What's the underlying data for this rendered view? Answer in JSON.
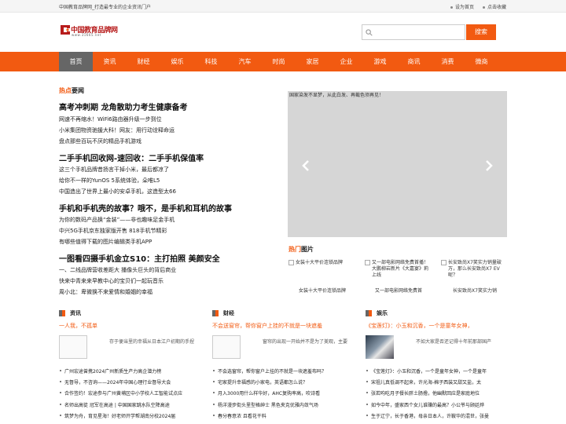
{
  "topbar": {
    "site_desc": "中国教育品牌网_打造最专业的企业资讯门户",
    "set_home": "设为首页",
    "bookmark": "点击收藏"
  },
  "logo": {
    "text": "中国教育品牌网",
    "sub": "www.31665.net"
  },
  "search": {
    "placeholder": "",
    "button": "搜索"
  },
  "nav": [
    "首页",
    "资讯",
    "财经",
    "娱乐",
    "科技",
    "汽车",
    "时尚",
    "家居",
    "企业",
    "游戏",
    "商讯",
    "消费",
    "微商"
  ],
  "hot": {
    "title_red": "热点",
    "title_rest": "要闻",
    "groups": [
      {
        "headline": "高考冲刺期 龙角散助力考生健康备考",
        "items": [
          "网速不再缩水！WiFi6路由器升级一步到位",
          "小米集团物资驰援大科！网友：用行动诠释命运",
          "盘点那些百玩不厌的精品手机游戏"
        ]
      },
      {
        "headline": "二手手机回收网-速回收：二手手机保值率",
        "items": [
          "这三个手机品牌昔扬言干掉小米，最后都凉了",
          "给你不一样的YunOS 5系统体验，朵唯L5",
          "中国造出了世界上最小的安卓手机，这造型太66"
        ]
      },
      {
        "headline": "手机和手机壳的故事？哦不，是手机和耳机的故事",
        "items": [
          "为你的数码产品换“金装”——非也趣味足金手机",
          "中兴5G手机京东独家版开售 818手机节精彩",
          "有哪些值得下载的图片编辑类手机APP"
        ]
      },
      {
        "headline": "一图看四摄手机金立S10：主打拍照 美颜安全",
        "items": [
          "一、二线品牌营收差距大 播像头巨头的背后商业",
          "快来中青来来早教中心的宝贝们一起玩音乐",
          "周小北：卑微换不来爱情和婚姻的幸福"
        ]
      }
    ]
  },
  "slider": {
    "caption": "国家染发不显梦，从此白发、再截色须再见！"
  },
  "pics": {
    "title_red": "热门",
    "title_rest": "图片",
    "items": [
      {
        "thumb": "女装十大平价连锁品牌",
        "caption": "女装十大平价连锁品牌"
      },
      {
        "thumb": "又一部电影网络免费首播！大鹏柳岩新片《大嘉宴》莉上线",
        "caption": "又一部电影网络免费首"
      },
      {
        "thumb": "长安致尚X7笑实力销量破万，那么长安致尚X7 EV呢？",
        "caption": "长安致尚X7笑实力销"
      }
    ]
  },
  "columns": [
    {
      "name": "资讯",
      "lead": "一人我，不孤单",
      "desc": "存于便当里的幸福从日本江户初期的手捏",
      "thumb_icon": "image-icon",
      "list": [
        "广州宏途曾携2024广州新质生产力高企潜力榜",
        "无督导，不咨询——2024年中国心理行业督导大会",
        "合作签约！宏途参与广州黄埔区中小学校人工智能试点应",
        "名师出高徒 冠军在高途 | 中国国家跳水队空降高途",
        "筑梦为舟，育见星海！好老师开学帮湖南分校2024届"
      ]
    },
    {
      "name": "财经",
      "lead": "不会送窗帘，帮你窗户上挂的不就是一块遮羞",
      "desc": "窗帘的出现一开始并不是为了美观，主要",
      "thumb_icon": "image-icon",
      "list": [
        "不会选窗帘，帮你窗户上挂的不就是一块遮羞布吗？",
        "宅家提升幸福感的小家电，英语都怎么说？",
        "月入3000用什么样华好，AHC复购率高，吹诗看",
        "杨洋漫步街头里型格绅士 黑色夹克优雅内敛气场",
        "春分春意浓 且看花干料"
      ]
    },
    {
      "name": "娱乐",
      "lead": "《宝莲灯》：小玉和沉香，一个是童年女神，",
      "desc": "不如大家是否还记得十年前那部国产",
      "thumb_icon": "photo",
      "list": [
        "《宝莲灯》：小玉和沉香，一个是童年女神，一个是童年",
        "宋祖儿真低调不起来，许光海-棉子西装又甜又盐，太",
        "张若昀吃月子餐长胖土肠撸，他幽默回应是家庭地位",
        "如今中年，盛家西个女儿谁赚的最高？小公爷与顾廷烨",
        "生于辽宁，长于香港，母亲日本人，许鞍华的混世，张曼"
      ]
    }
  ]
}
